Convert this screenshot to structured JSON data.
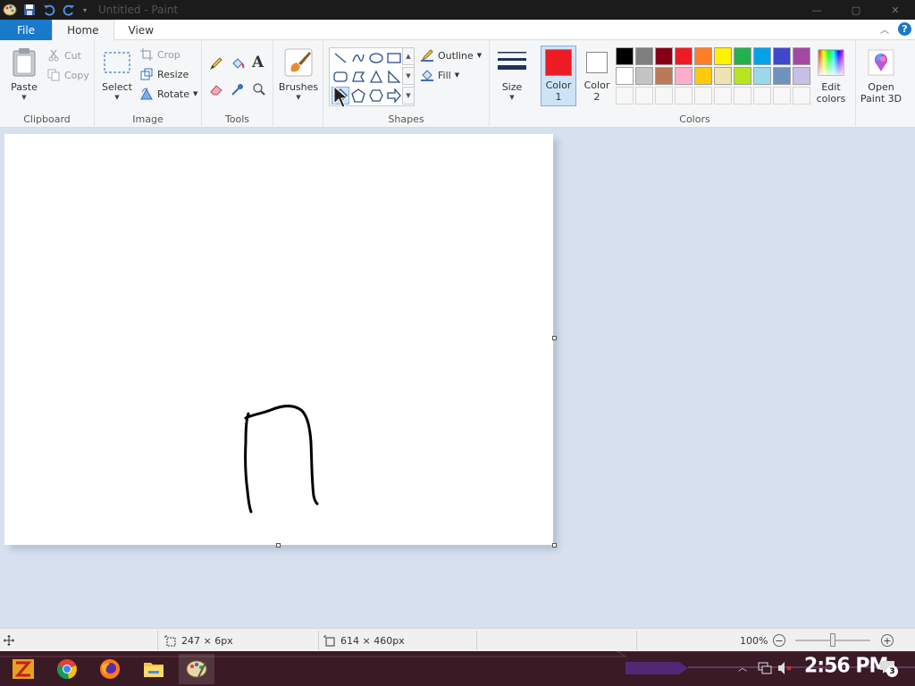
{
  "titlebar": {
    "title": "Untitled - Paint"
  },
  "tabs": {
    "file": "File",
    "home": "Home",
    "view": "View",
    "help": "?"
  },
  "clipboard": {
    "paste": "Paste",
    "cut": "Cut",
    "copy": "Copy",
    "label": "Clipboard"
  },
  "image": {
    "select": "Select",
    "crop": "Crop",
    "resize": "Resize",
    "rotate": "Rotate",
    "label": "Image"
  },
  "tools": {
    "label": "Tools",
    "text_glyph": "A"
  },
  "brushes": {
    "label": "Brushes"
  },
  "shapes": {
    "outline": "Outline",
    "fill": "Fill",
    "label": "Shapes"
  },
  "size": {
    "label": "Size"
  },
  "colors": {
    "color1": "Color 1",
    "color1_line1": "Color",
    "color1_line2": "1",
    "color2_line1": "Color",
    "color2_line2": "2",
    "color1_value": "#ed1c24",
    "color2_value": "#ffffff",
    "edit_line1": "Edit",
    "edit_line2": "colors",
    "label": "Colors",
    "palette_row1": [
      "#000000",
      "#7f7f7f",
      "#880015",
      "#ed1c24",
      "#ff7f27",
      "#fff200",
      "#22b14c",
      "#00a2e8",
      "#3f48cc",
      "#a349a4"
    ],
    "palette_row2": [
      "#ffffff",
      "#c3c3c3",
      "#b97a57",
      "#ffaec9",
      "#ffc90e",
      "#efe4b0",
      "#b5e61d",
      "#99d9ea",
      "#7092be",
      "#c8bfe7"
    ]
  },
  "paint3d": {
    "line1": "Open",
    "line2": "Paint 3D"
  },
  "status": {
    "selection_size": "247 × 6px",
    "canvas_size": "614 × 460px",
    "zoom": "100%"
  },
  "taskbar": {
    "clock": "2:56 PM",
    "notifications": "3"
  }
}
